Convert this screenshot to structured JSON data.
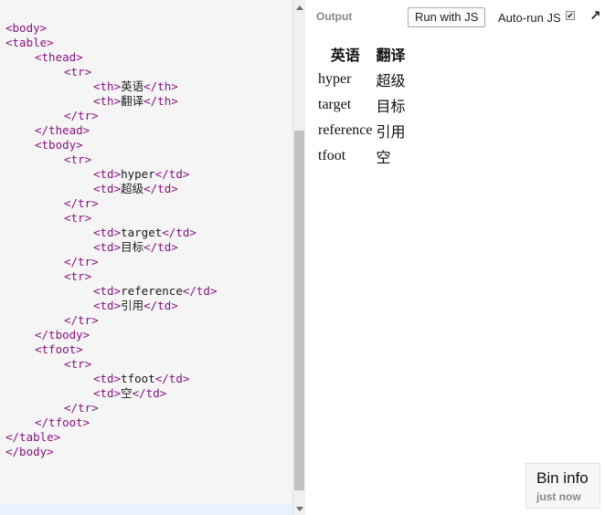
{
  "editor": {
    "lines": [
      {
        "indent": 0,
        "parts": [
          {
            "c": "tag",
            "t": "<body>"
          }
        ]
      },
      {
        "indent": 0,
        "parts": [
          {
            "c": "tag",
            "t": "<table>"
          }
        ]
      },
      {
        "indent": 1,
        "parts": [
          {
            "c": "tag",
            "t": "<thead>"
          }
        ]
      },
      {
        "indent": 2,
        "parts": [
          {
            "c": "tag",
            "t": "<tr>"
          }
        ]
      },
      {
        "indent": 3,
        "parts": [
          {
            "c": "tag",
            "t": "<th>"
          },
          {
            "c": "txt",
            "t": "英语"
          },
          {
            "c": "tag",
            "t": "</th>"
          }
        ]
      },
      {
        "indent": 3,
        "parts": [
          {
            "c": "tag",
            "t": "<th>"
          },
          {
            "c": "txt",
            "t": "翻译"
          },
          {
            "c": "tag",
            "t": "</th>"
          }
        ]
      },
      {
        "indent": 2,
        "parts": [
          {
            "c": "tag",
            "t": "</tr>"
          }
        ]
      },
      {
        "indent": 1,
        "parts": [
          {
            "c": "tag",
            "t": "</thead>"
          }
        ]
      },
      {
        "indent": 1,
        "parts": [
          {
            "c": "tag",
            "t": "<tbody>"
          }
        ]
      },
      {
        "indent": 2,
        "parts": [
          {
            "c": "tag",
            "t": "<tr>"
          }
        ]
      },
      {
        "indent": 3,
        "parts": [
          {
            "c": "tag",
            "t": "<td>"
          },
          {
            "c": "txt",
            "t": "hyper"
          },
          {
            "c": "tag",
            "t": "</td>"
          }
        ]
      },
      {
        "indent": 3,
        "parts": [
          {
            "c": "tag",
            "t": "<td>"
          },
          {
            "c": "txt",
            "t": "超级"
          },
          {
            "c": "tag",
            "t": "</td>"
          }
        ]
      },
      {
        "indent": 2,
        "parts": [
          {
            "c": "tag",
            "t": "</tr>"
          }
        ]
      },
      {
        "indent": 2,
        "parts": [
          {
            "c": "tag",
            "t": "<tr>"
          }
        ]
      },
      {
        "indent": 3,
        "parts": [
          {
            "c": "tag",
            "t": "<td>"
          },
          {
            "c": "txt",
            "t": "target"
          },
          {
            "c": "tag",
            "t": "</td>"
          }
        ]
      },
      {
        "indent": 3,
        "parts": [
          {
            "c": "tag",
            "t": "<td>"
          },
          {
            "c": "txt",
            "t": "目标"
          },
          {
            "c": "tag",
            "t": "</td>"
          }
        ]
      },
      {
        "indent": 2,
        "parts": [
          {
            "c": "tag",
            "t": "</tr>"
          }
        ]
      },
      {
        "indent": 2,
        "parts": [
          {
            "c": "tag",
            "t": "<tr>"
          }
        ]
      },
      {
        "indent": 3,
        "parts": [
          {
            "c": "tag",
            "t": "<td>"
          },
          {
            "c": "txt",
            "t": "reference"
          },
          {
            "c": "tag",
            "t": "</td>"
          }
        ]
      },
      {
        "indent": 3,
        "parts": [
          {
            "c": "tag",
            "t": "<td>"
          },
          {
            "c": "txt",
            "t": "引用"
          },
          {
            "c": "tag",
            "t": "</td>"
          }
        ]
      },
      {
        "indent": 2,
        "parts": [
          {
            "c": "tag",
            "t": "</tr>"
          }
        ]
      },
      {
        "indent": 1,
        "parts": [
          {
            "c": "tag",
            "t": "</tbody>"
          }
        ]
      },
      {
        "indent": 1,
        "parts": [
          {
            "c": "tag",
            "t": "<tfoot>"
          }
        ]
      },
      {
        "indent": 2,
        "parts": [
          {
            "c": "tag",
            "t": "<tr>"
          }
        ]
      },
      {
        "indent": 3,
        "parts": [
          {
            "c": "tag",
            "t": "<td>"
          },
          {
            "c": "txt",
            "t": "tfoot"
          },
          {
            "c": "tag",
            "t": "</td>"
          }
        ]
      },
      {
        "indent": 3,
        "parts": [
          {
            "c": "tag",
            "t": "<td>"
          },
          {
            "c": "txt",
            "t": "空"
          },
          {
            "c": "tag",
            "t": "</td>"
          }
        ]
      },
      {
        "indent": 2,
        "parts": [
          {
            "c": "tag",
            "t": "</tr>"
          }
        ]
      },
      {
        "indent": 1,
        "parts": [
          {
            "c": "tag",
            "t": "</tfoot>"
          }
        ]
      },
      {
        "indent": 0,
        "parts": [
          {
            "c": "tag",
            "t": "</table>"
          }
        ]
      },
      {
        "indent": 0,
        "parts": [
          {
            "c": "tag",
            "t": "</body>"
          }
        ]
      }
    ]
  },
  "output": {
    "label": "Output",
    "run_button": "Run with JS",
    "autorun_label": "Auto-run JS",
    "autorun_checked": true,
    "table": {
      "headers": [
        "英语",
        "翻译"
      ],
      "rows": [
        [
          "hyper",
          "超级"
        ],
        [
          "target",
          "目标"
        ],
        [
          "reference",
          "引用"
        ],
        [
          "tfoot",
          "空"
        ]
      ]
    }
  },
  "bin_info": {
    "title": "Bin info",
    "subtitle": "just now"
  }
}
